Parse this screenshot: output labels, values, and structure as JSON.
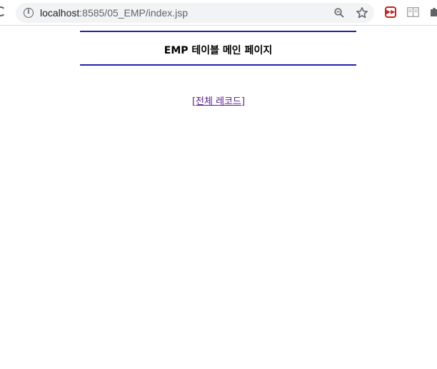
{
  "browser": {
    "url_host": "localhost",
    "url_rest": ":8585/05_EMP/index.jsp",
    "icons": [
      "reload-icon",
      "info-icon",
      "zoom-icon",
      "star-icon",
      "extension-red-icon",
      "reader-icon",
      "puzzle-icon"
    ]
  },
  "page": {
    "title": "EMP 테이블 메인 페이지",
    "link_label": "[전체 레코드]",
    "colors": {
      "rule": "#2222aa",
      "visited_link": "#551a8b"
    }
  }
}
